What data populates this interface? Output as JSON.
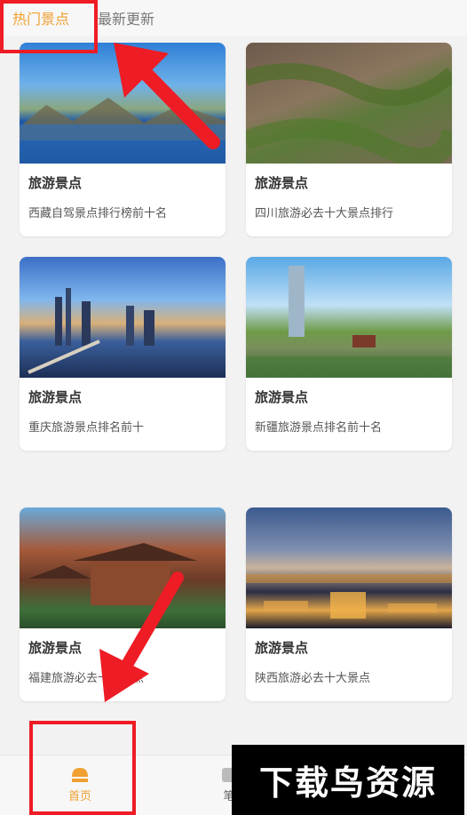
{
  "tabs": {
    "hot": "热门景点",
    "new": "最新更新"
  },
  "cards": [
    {
      "title": "旅游景点",
      "desc": "西藏自驾景点排行榜前十名"
    },
    {
      "title": "旅游景点",
      "desc": "四川旅游必去十大景点排行"
    },
    {
      "title": "旅游景点",
      "desc": "重庆旅游景点排名前十"
    },
    {
      "title": "旅游景点",
      "desc": "新疆旅游景点排名前十名"
    },
    {
      "title": "旅游景点",
      "desc": "福建旅游必去十大景点"
    },
    {
      "title": "旅游景点",
      "desc": "陕西旅游必去十大景点"
    }
  ],
  "nav": {
    "home": "首页",
    "notes": "笔"
  },
  "watermark": "下载鸟资源",
  "colors": {
    "accent": "#f0a030",
    "annotation": "#ee1c25"
  }
}
